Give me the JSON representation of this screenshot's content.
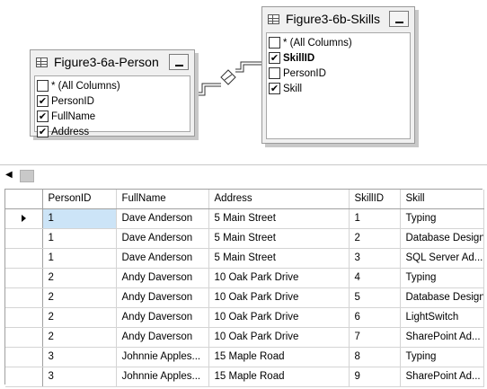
{
  "tables": {
    "person": {
      "title": "Figure3-6a-Person",
      "columns": [
        {
          "label": "* (All Columns)",
          "checked": false,
          "bold": false
        },
        {
          "label": "PersonID",
          "checked": true,
          "bold": false
        },
        {
          "label": "FullName",
          "checked": true,
          "bold": false
        },
        {
          "label": "Address",
          "checked": true,
          "bold": false
        }
      ]
    },
    "skills": {
      "title": "Figure3-6b-Skills",
      "columns": [
        {
          "label": "* (All Columns)",
          "checked": false,
          "bold": false
        },
        {
          "label": "SkillID",
          "checked": true,
          "bold": true
        },
        {
          "label": "PersonID",
          "checked": false,
          "bold": false
        },
        {
          "label": "Skill",
          "checked": true,
          "bold": false
        }
      ]
    }
  },
  "grid": {
    "headers": [
      "PersonID",
      "FullName",
      "Address",
      "SkillID",
      "Skill"
    ],
    "rows": [
      [
        "1",
        "Dave Anderson",
        "5 Main Street",
        "1",
        "Typing"
      ],
      [
        "1",
        "Dave Anderson",
        "5 Main Street",
        "2",
        "Database Design"
      ],
      [
        "1",
        "Dave Anderson",
        "5 Main Street",
        "3",
        "SQL Server Ad..."
      ],
      [
        "2",
        "Andy Daverson",
        "10 Oak Park Drive",
        "4",
        "Typing"
      ],
      [
        "2",
        "Andy Daverson",
        "10 Oak Park Drive",
        "5",
        "Database Design"
      ],
      [
        "2",
        "Andy Daverson",
        "10 Oak Park Drive",
        "6",
        "LightSwitch"
      ],
      [
        "2",
        "Andy Daverson",
        "10 Oak Park Drive",
        "7",
        "SharePoint Ad..."
      ],
      [
        "3",
        "Johnnie Apples...",
        "15 Maple Road",
        "8",
        "Typing"
      ],
      [
        "3",
        "Johnnie Apples...",
        "15 Maple Road",
        "9",
        "SharePoint Ad..."
      ]
    ],
    "current_row": 0
  },
  "icons": {
    "table_icon": "table-grid-icon",
    "minimize": "minimize-icon",
    "check": "✔",
    "current_row": "row-pointer-icon",
    "scroll_left": "◀"
  },
  "colors": {
    "selected_cell": "#cce4f7",
    "window_bg": "#f0f0f0"
  }
}
